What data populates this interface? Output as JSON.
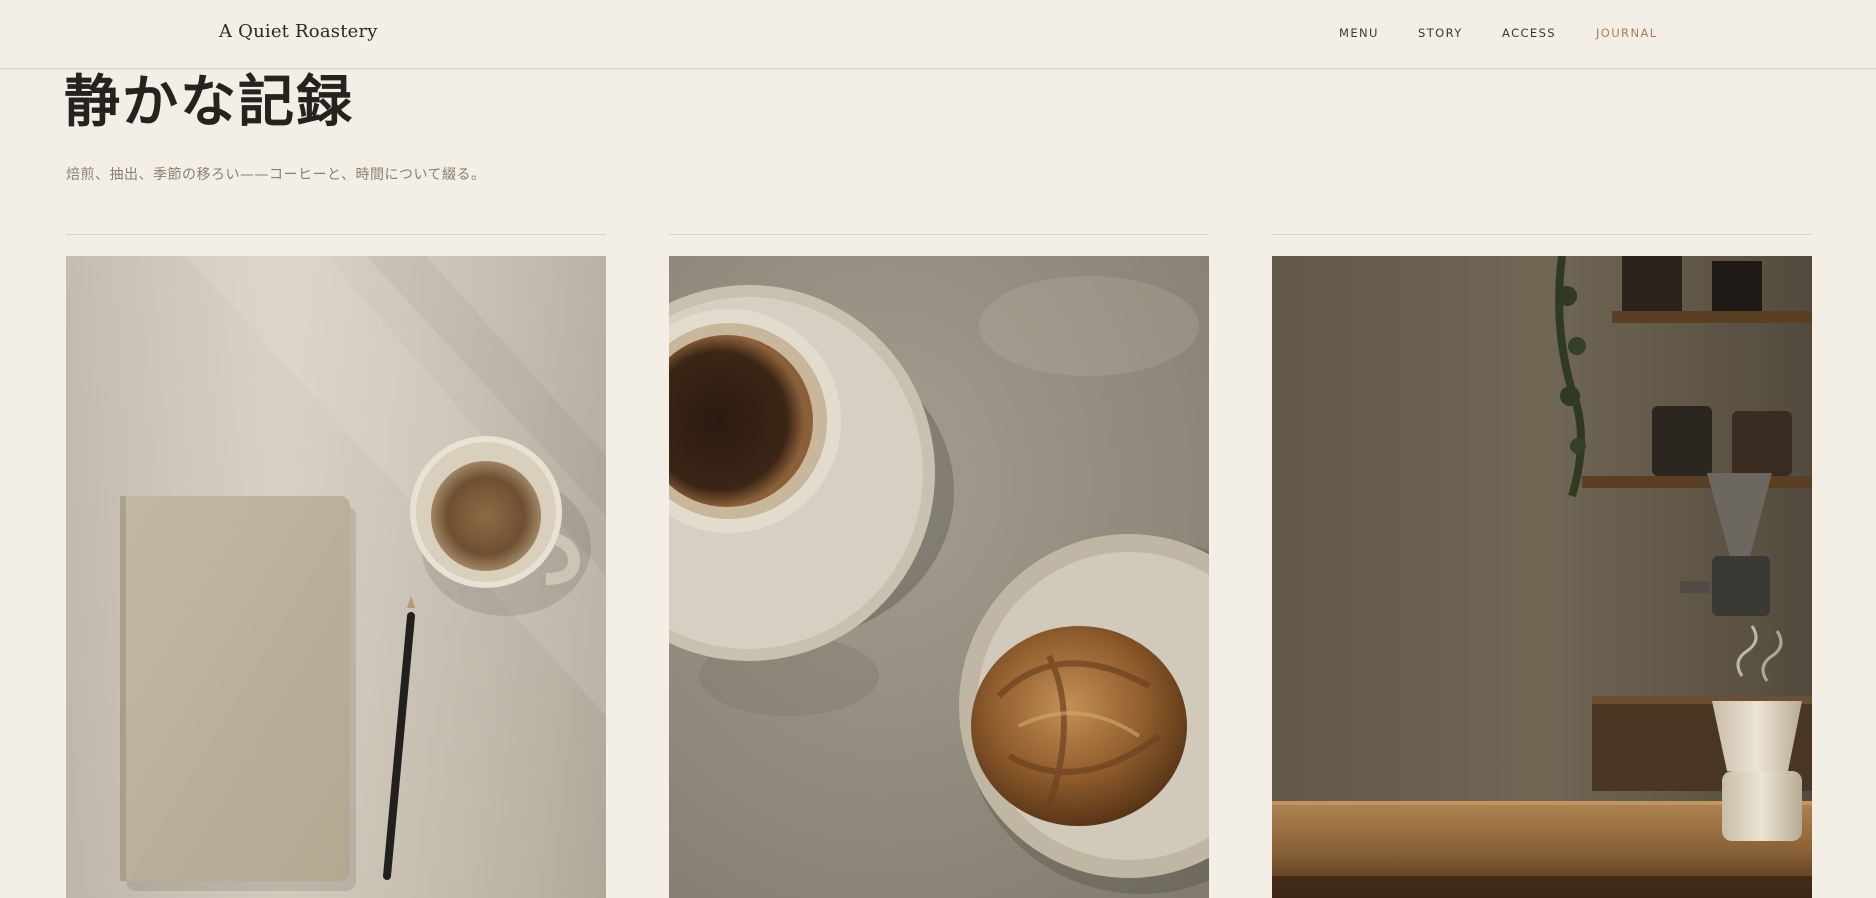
{
  "header": {
    "brand": "A Quiet Roastery",
    "nav": [
      {
        "label": "MENU",
        "active": false
      },
      {
        "label": "STORY",
        "active": false
      },
      {
        "label": "ACCESS",
        "active": false
      },
      {
        "label": "JOURNAL",
        "active": true
      }
    ]
  },
  "hero": {
    "title": "静かな記録",
    "subtitle": "焙煎、抽出、季節の移ろい——コーヒーと、時間について綴る。"
  },
  "colors": {
    "background": "#f3efe7",
    "accent": "#b07a52",
    "text": "#2d2a25",
    "muted": "#8a7f6d"
  },
  "journal": {
    "cards": [
      {
        "image": "notebook-coffee-photo"
      },
      {
        "image": "coffee-pastry-photo"
      },
      {
        "image": "cafe-counter-photo"
      }
    ]
  }
}
